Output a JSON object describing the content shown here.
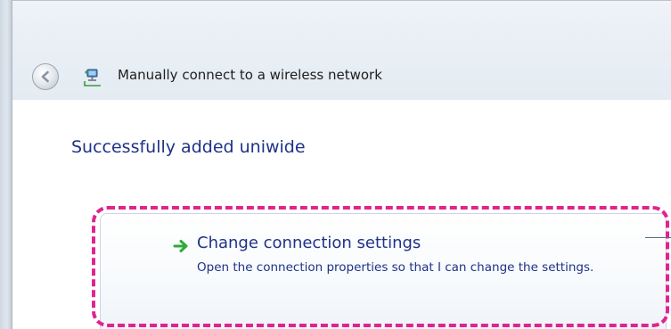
{
  "window": {
    "title": "Manually connect to a wireless network",
    "back_icon": "back-arrow-icon",
    "wizard_icon": "wireless-network-icon"
  },
  "main": {
    "heading": "Successfully added uniwide",
    "command_link": {
      "icon": "green-arrow-icon",
      "title": "Change connection settings",
      "description": "Open the connection properties so that I can change the settings."
    }
  },
  "colors": {
    "heading_text": "#1e3287",
    "highlight": "#e0248f",
    "arrow_green": "#2faa34"
  }
}
